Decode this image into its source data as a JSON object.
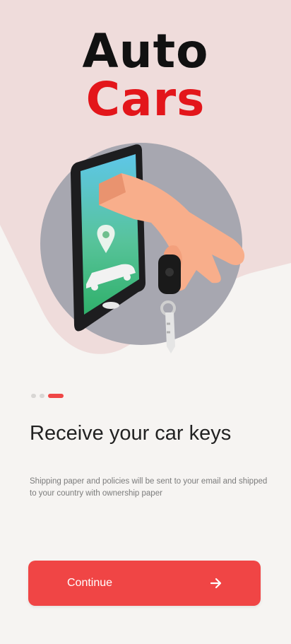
{
  "logo": {
    "line1": "Auto",
    "line2": "Cars"
  },
  "onboarding": {
    "title": "Receive your car keys",
    "description": "Shipping paper and policies will be sent to your email and shipped to your country with ownership paper",
    "steps_total": 3,
    "active_step": 3
  },
  "continue_button": {
    "label": "Continue",
    "icon": "arrow-right-icon"
  },
  "colors": {
    "accent": "#f04545",
    "brand_red": "#e3161b",
    "background": "#f6f4f2",
    "header_pink": "#efdcdb"
  }
}
